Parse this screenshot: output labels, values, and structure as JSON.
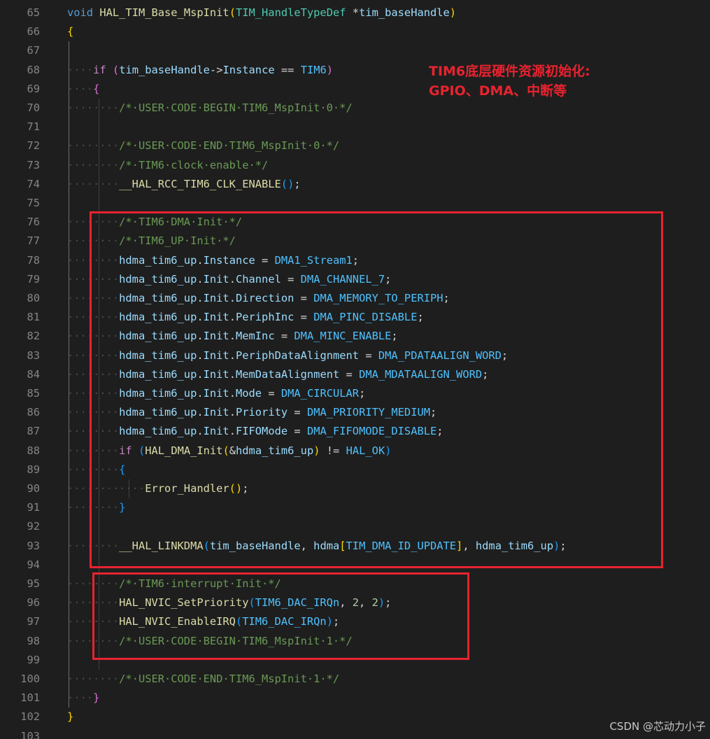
{
  "watermark": "CSDN @芯动力小子",
  "annotation": {
    "line1": "TIM6底层硬件资源初始化:",
    "line2": "GPIO、DMA、中断等"
  },
  "colors": {
    "background": "#1e1e1e",
    "highlight_box": "#e8232f",
    "line_number": "#858585"
  },
  "lines": [
    {
      "n": "65",
      "segs": [
        [
          "void",
          "kw"
        ],
        [
          " ",
          "op"
        ],
        [
          "HAL_TIM_Base_MspInit",
          "fn"
        ],
        [
          "(",
          "p1"
        ],
        [
          "TIM_HandleTypeDef",
          "ty"
        ],
        [
          " ",
          "op"
        ],
        [
          "*",
          "op"
        ],
        [
          "tim_baseHandle",
          "var"
        ],
        [
          ")",
          "p1"
        ]
      ]
    },
    {
      "n": "66",
      "segs": [
        [
          "{",
          "p1"
        ]
      ]
    },
    {
      "n": "67",
      "segs": []
    },
    {
      "n": "68",
      "segs": [
        [
          "····",
          "ws"
        ],
        [
          "if",
          "ctl"
        ],
        [
          " ",
          "op"
        ],
        [
          "(",
          "p2"
        ],
        [
          "tim_baseHandle",
          "var"
        ],
        [
          "->",
          "op"
        ],
        [
          "Instance",
          "var"
        ],
        [
          " ",
          "op"
        ],
        [
          "==",
          "op"
        ],
        [
          " ",
          "op"
        ],
        [
          "TIM6",
          "mac"
        ],
        [
          ")",
          "p2"
        ]
      ]
    },
    {
      "n": "69",
      "segs": [
        [
          "····",
          "ws"
        ],
        [
          "{",
          "p2"
        ]
      ]
    },
    {
      "n": "70",
      "segs": [
        [
          "········",
          "ws"
        ],
        [
          "/*·USER·CODE·BEGIN·TIM6_MspInit·0·*/",
          "cm"
        ]
      ]
    },
    {
      "n": "71",
      "segs": []
    },
    {
      "n": "72",
      "segs": [
        [
          "········",
          "ws"
        ],
        [
          "/*·USER·CODE·END·TIM6_MspInit·0·*/",
          "cm"
        ]
      ]
    },
    {
      "n": "73",
      "segs": [
        [
          "········",
          "ws"
        ],
        [
          "/*·TIM6·clock·enable·*/",
          "cm"
        ]
      ]
    },
    {
      "n": "74",
      "segs": [
        [
          "········",
          "ws"
        ],
        [
          "__HAL_RCC_TIM6_CLK_ENABLE",
          "fn"
        ],
        [
          "()",
          "p3"
        ],
        [
          ";",
          "op"
        ]
      ]
    },
    {
      "n": "75",
      "segs": []
    },
    {
      "n": "76",
      "segs": [
        [
          "········",
          "ws"
        ],
        [
          "/*·TIM6·DMA·Init·*/",
          "cm"
        ]
      ]
    },
    {
      "n": "77",
      "segs": [
        [
          "········",
          "ws"
        ],
        [
          "/*·TIM6_UP·Init·*/",
          "cm"
        ]
      ]
    },
    {
      "n": "78",
      "segs": [
        [
          "········",
          "ws"
        ],
        [
          "hdma_tim6_up",
          "var"
        ],
        [
          ".",
          "op"
        ],
        [
          "Instance",
          "var"
        ],
        [
          " = ",
          "op"
        ],
        [
          "DMA1_Stream1",
          "mac"
        ],
        [
          ";",
          "op"
        ]
      ]
    },
    {
      "n": "79",
      "segs": [
        [
          "········",
          "ws"
        ],
        [
          "hdma_tim6_up",
          "var"
        ],
        [
          ".",
          "op"
        ],
        [
          "Init",
          "var"
        ],
        [
          ".",
          "op"
        ],
        [
          "Channel",
          "var"
        ],
        [
          " = ",
          "op"
        ],
        [
          "DMA_CHANNEL_7",
          "mac"
        ],
        [
          ";",
          "op"
        ]
      ]
    },
    {
      "n": "80",
      "segs": [
        [
          "········",
          "ws"
        ],
        [
          "hdma_tim6_up",
          "var"
        ],
        [
          ".",
          "op"
        ],
        [
          "Init",
          "var"
        ],
        [
          ".",
          "op"
        ],
        [
          "Direction",
          "var"
        ],
        [
          " = ",
          "op"
        ],
        [
          "DMA_MEMORY_TO_PERIPH",
          "mac"
        ],
        [
          ";",
          "op"
        ]
      ]
    },
    {
      "n": "81",
      "segs": [
        [
          "········",
          "ws"
        ],
        [
          "hdma_tim6_up",
          "var"
        ],
        [
          ".",
          "op"
        ],
        [
          "Init",
          "var"
        ],
        [
          ".",
          "op"
        ],
        [
          "PeriphInc",
          "var"
        ],
        [
          " = ",
          "op"
        ],
        [
          "DMA_PINC_DISABLE",
          "mac"
        ],
        [
          ";",
          "op"
        ]
      ]
    },
    {
      "n": "82",
      "segs": [
        [
          "········",
          "ws"
        ],
        [
          "hdma_tim6_up",
          "var"
        ],
        [
          ".",
          "op"
        ],
        [
          "Init",
          "var"
        ],
        [
          ".",
          "op"
        ],
        [
          "MemInc",
          "var"
        ],
        [
          " = ",
          "op"
        ],
        [
          "DMA_MINC_ENABLE",
          "mac"
        ],
        [
          ";",
          "op"
        ]
      ]
    },
    {
      "n": "83",
      "segs": [
        [
          "········",
          "ws"
        ],
        [
          "hdma_tim6_up",
          "var"
        ],
        [
          ".",
          "op"
        ],
        [
          "Init",
          "var"
        ],
        [
          ".",
          "op"
        ],
        [
          "PeriphDataAlignment",
          "var"
        ],
        [
          " = ",
          "op"
        ],
        [
          "DMA_PDATAALIGN_WORD",
          "mac"
        ],
        [
          ";",
          "op"
        ]
      ]
    },
    {
      "n": "84",
      "segs": [
        [
          "········",
          "ws"
        ],
        [
          "hdma_tim6_up",
          "var"
        ],
        [
          ".",
          "op"
        ],
        [
          "Init",
          "var"
        ],
        [
          ".",
          "op"
        ],
        [
          "MemDataAlignment",
          "var"
        ],
        [
          " = ",
          "op"
        ],
        [
          "DMA_MDATAALIGN_WORD",
          "mac"
        ],
        [
          ";",
          "op"
        ]
      ]
    },
    {
      "n": "85",
      "segs": [
        [
          "········",
          "ws"
        ],
        [
          "hdma_tim6_up",
          "var"
        ],
        [
          ".",
          "op"
        ],
        [
          "Init",
          "var"
        ],
        [
          ".",
          "op"
        ],
        [
          "Mode",
          "var"
        ],
        [
          " = ",
          "op"
        ],
        [
          "DMA_CIRCULAR",
          "mac"
        ],
        [
          ";",
          "op"
        ]
      ]
    },
    {
      "n": "86",
      "segs": [
        [
          "········",
          "ws"
        ],
        [
          "hdma_tim6_up",
          "var"
        ],
        [
          ".",
          "op"
        ],
        [
          "Init",
          "var"
        ],
        [
          ".",
          "op"
        ],
        [
          "Priority",
          "var"
        ],
        [
          " = ",
          "op"
        ],
        [
          "DMA_PRIORITY_MEDIUM",
          "mac"
        ],
        [
          ";",
          "op"
        ]
      ]
    },
    {
      "n": "87",
      "segs": [
        [
          "········",
          "ws"
        ],
        [
          "hdma_tim6_up",
          "var"
        ],
        [
          ".",
          "op"
        ],
        [
          "Init",
          "var"
        ],
        [
          ".",
          "op"
        ],
        [
          "FIFOMode",
          "var"
        ],
        [
          " = ",
          "op"
        ],
        [
          "DMA_FIFOMODE_DISABLE",
          "mac"
        ],
        [
          ";",
          "op"
        ]
      ]
    },
    {
      "n": "88",
      "segs": [
        [
          "········",
          "ws"
        ],
        [
          "if",
          "ctl"
        ],
        [
          " ",
          "op"
        ],
        [
          "(",
          "p3"
        ],
        [
          "HAL_DMA_Init",
          "fn"
        ],
        [
          "(",
          "p1"
        ],
        [
          "&",
          "op"
        ],
        [
          "hdma_tim6_up",
          "var"
        ],
        [
          ")",
          "p1"
        ],
        [
          " ",
          "op"
        ],
        [
          "!=",
          "op"
        ],
        [
          " ",
          "op"
        ],
        [
          "HAL_OK",
          "mac"
        ],
        [
          ")",
          "p3"
        ]
      ]
    },
    {
      "n": "89",
      "segs": [
        [
          "········",
          "ws"
        ],
        [
          "{",
          "p3"
        ]
      ]
    },
    {
      "n": "90",
      "segs": [
        [
          "············",
          "ws"
        ],
        [
          "Error_Handler",
          "fn"
        ],
        [
          "()",
          "p1"
        ],
        [
          ";",
          "op"
        ]
      ]
    },
    {
      "n": "91",
      "segs": [
        [
          "········",
          "ws"
        ],
        [
          "}",
          "p3"
        ]
      ]
    },
    {
      "n": "92",
      "segs": []
    },
    {
      "n": "93",
      "segs": [
        [
          "········",
          "ws"
        ],
        [
          "__HAL_LINKDMA",
          "fn"
        ],
        [
          "(",
          "p3"
        ],
        [
          "tim_baseHandle",
          "var"
        ],
        [
          ", ",
          "op"
        ],
        [
          "hdma",
          "var"
        ],
        [
          "[",
          "p1"
        ],
        [
          "TIM_DMA_ID_UPDATE",
          "mac"
        ],
        [
          "]",
          "p1"
        ],
        [
          ", ",
          "op"
        ],
        [
          "hdma_tim6_up",
          "var"
        ],
        [
          ")",
          "p3"
        ],
        [
          ";",
          "op"
        ]
      ]
    },
    {
      "n": "94",
      "segs": []
    },
    {
      "n": "95",
      "segs": [
        [
          "········",
          "ws"
        ],
        [
          "/*·TIM6·interrupt·Init·*/",
          "cm"
        ]
      ]
    },
    {
      "n": "96",
      "segs": [
        [
          "········",
          "ws"
        ],
        [
          "HAL_NVIC_SetPriority",
          "fn"
        ],
        [
          "(",
          "p3"
        ],
        [
          "TIM6_DAC_IRQn",
          "mac"
        ],
        [
          ", ",
          "op"
        ],
        [
          "2",
          "num"
        ],
        [
          ", ",
          "op"
        ],
        [
          "2",
          "num"
        ],
        [
          ")",
          "p3"
        ],
        [
          ";",
          "op"
        ]
      ]
    },
    {
      "n": "97",
      "segs": [
        [
          "········",
          "ws"
        ],
        [
          "HAL_NVIC_EnableIRQ",
          "fn"
        ],
        [
          "(",
          "p3"
        ],
        [
          "TIM6_DAC_IRQn",
          "mac"
        ],
        [
          ")",
          "p3"
        ],
        [
          ";",
          "op"
        ]
      ]
    },
    {
      "n": "98",
      "segs": [
        [
          "········",
          "ws"
        ],
        [
          "/*·USER·CODE·BEGIN·TIM6_MspInit·1·*/",
          "cm"
        ]
      ]
    },
    {
      "n": "99",
      "segs": []
    },
    {
      "n": "100",
      "segs": [
        [
          "········",
          "ws"
        ],
        [
          "/*·USER·CODE·END·TIM6_MspInit·1·*/",
          "cm"
        ]
      ]
    },
    {
      "n": "101",
      "segs": [
        [
          "····",
          "ws"
        ],
        [
          "}",
          "p2"
        ]
      ]
    },
    {
      "n": "102",
      "segs": [
        [
          "}",
          "p1"
        ]
      ]
    },
    {
      "n": "103",
      "segs": []
    }
  ]
}
